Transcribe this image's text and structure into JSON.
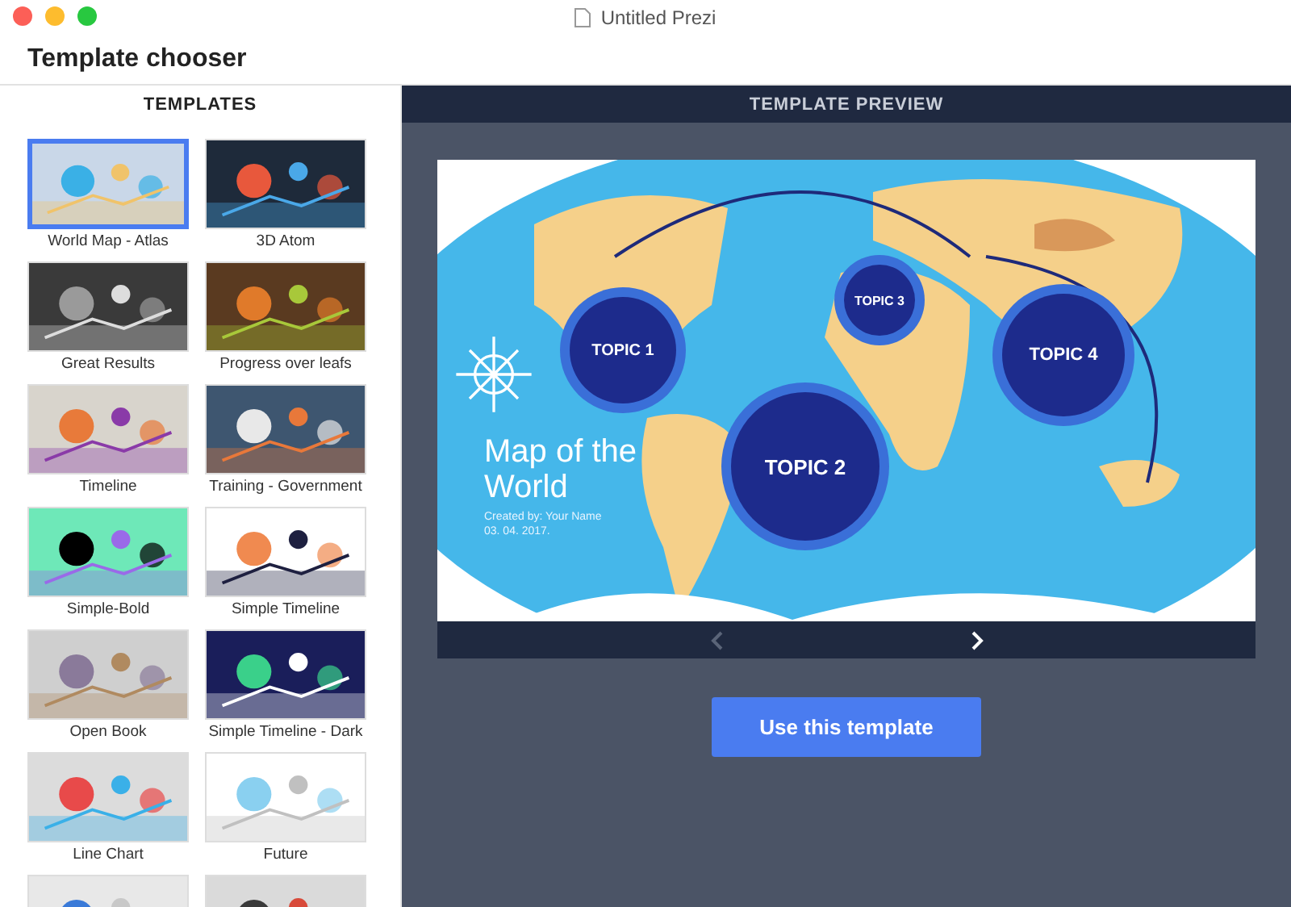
{
  "window": {
    "title": "Untitled Prezi"
  },
  "header": {
    "title": "Template chooser"
  },
  "templates": {
    "title": "TEMPLATES",
    "items": [
      {
        "name": "World Map - Atlas",
        "selected": true
      },
      {
        "name": "3D Atom",
        "selected": false
      },
      {
        "name": "Great Results",
        "selected": false
      },
      {
        "name": "Progress over leafs",
        "selected": false
      },
      {
        "name": "Timeline",
        "selected": false
      },
      {
        "name": "Training - Government",
        "selected": false
      },
      {
        "name": "Simple-Bold",
        "selected": false
      },
      {
        "name": "Simple Timeline",
        "selected": false
      },
      {
        "name": "Open Book",
        "selected": false
      },
      {
        "name": "Simple Timeline - Dark",
        "selected": false
      },
      {
        "name": "Line Chart",
        "selected": false
      },
      {
        "name": "Future",
        "selected": false
      },
      {
        "selected": false
      },
      {
        "selected": false
      }
    ]
  },
  "preview": {
    "title": "TEMPLATE PREVIEW",
    "slide": {
      "topics": [
        {
          "label": "TOPIC 1"
        },
        {
          "label": "TOPIC 3"
        },
        {
          "label": "TOPIC 4"
        },
        {
          "label": "TOPIC 2"
        }
      ],
      "title": "Map of the World",
      "credit": "Created by: Your Name",
      "date": "03. 04. 2017."
    },
    "nav": {
      "previous_disabled": true,
      "next_disabled": false
    },
    "button": "Use this template"
  }
}
